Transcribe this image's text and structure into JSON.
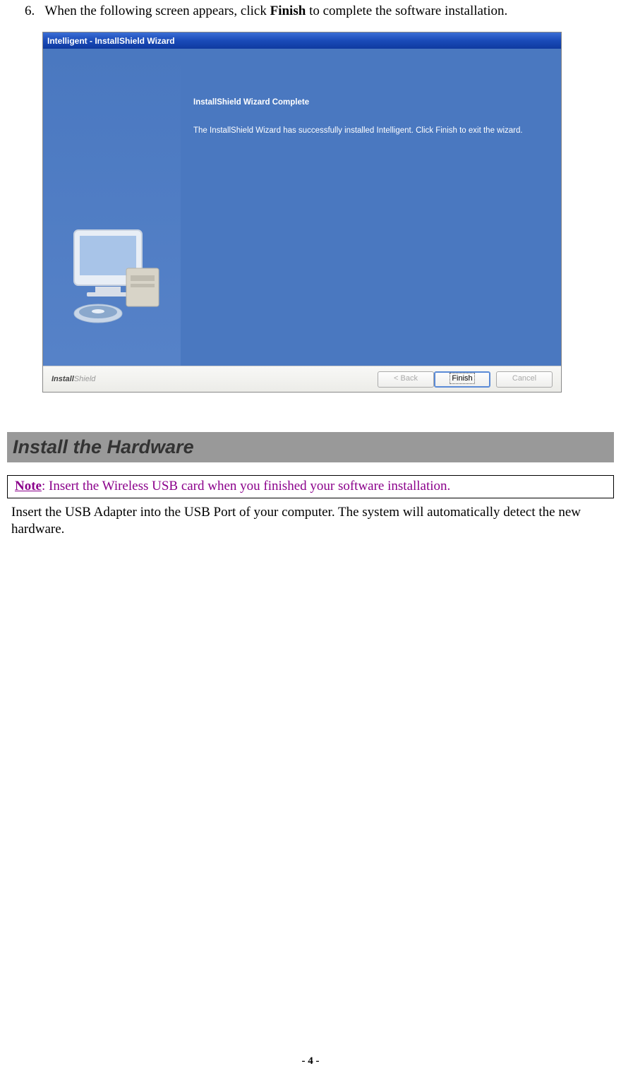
{
  "step": {
    "number": "6.",
    "text_before": "When the following screen appears, click ",
    "bold": "Finish",
    "text_after": " to complete the software installation."
  },
  "dialog": {
    "title": "Intelligent - InstallShield Wizard",
    "heading": "InstallShield Wizard Complete",
    "body": "The InstallShield Wizard has successfully installed Intelligent.  Click Finish to exit the wizard.",
    "footer_brand_a": "Install",
    "footer_brand_b": "Shield",
    "back": "< Back",
    "finish": "Finish",
    "cancel": "Cancel"
  },
  "section": {
    "heading": "Install the Hardware",
    "note_label": "Note",
    "note_text": ": Insert the Wireless USB card when you finished your software installation.",
    "body": "Insert the USB Adapter into the USB Port of your computer. The system will automatically detect the new hardware."
  },
  "page_number": "- 4 -"
}
